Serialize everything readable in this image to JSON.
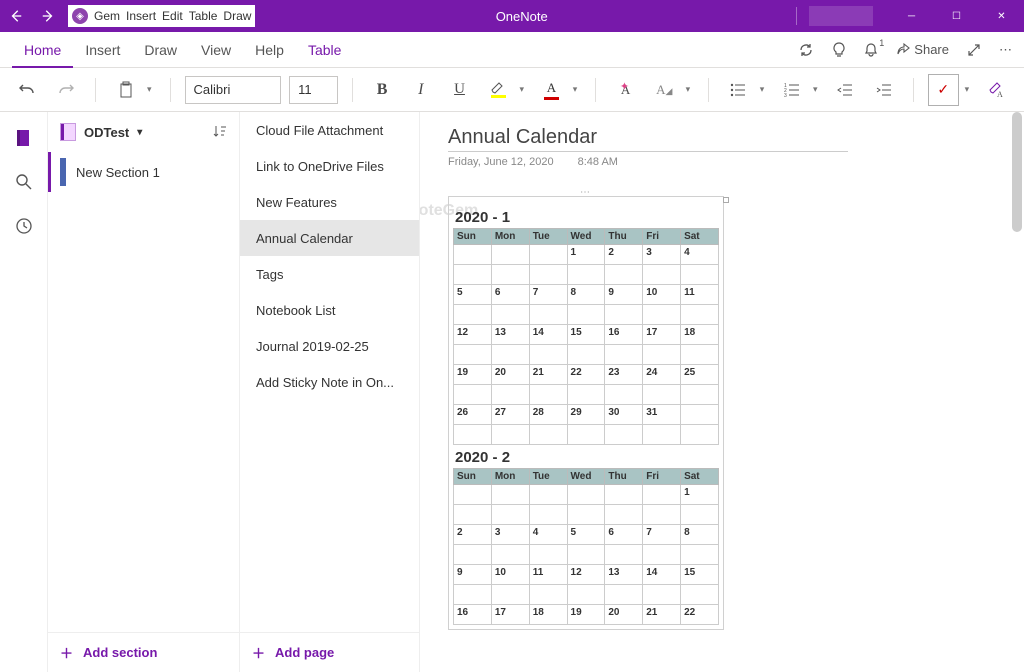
{
  "title_bar": {
    "app_name": "OneNote",
    "gem_menu": {
      "label": "Gem",
      "items": [
        "Insert",
        "Edit",
        "Table",
        "Draw"
      ]
    }
  },
  "ribbon_tabs": {
    "tabs": [
      "Home",
      "Insert",
      "Draw",
      "View",
      "Help",
      "Table"
    ],
    "active": "Home",
    "share_label": "Share",
    "bell_badge": "1"
  },
  "ribbon": {
    "font_name": "Calibri",
    "font_size": "11"
  },
  "notebook": {
    "name": "ODTest",
    "sections": [
      {
        "name": "New Section 1"
      }
    ],
    "add_section": "Add section"
  },
  "pages": {
    "items": [
      "Cloud File Attachment",
      "Link to OneDrive Files",
      "New Features",
      "Annual Calendar",
      "Tags",
      "Notebook List",
      "Journal 2019-02-25",
      "Add Sticky Note in On..."
    ],
    "active_index": 3,
    "add_page": "Add page"
  },
  "page": {
    "title": "Annual Calendar",
    "date": "Friday, June 12, 2020",
    "time": "8:48 AM",
    "watermark": "OneNoteGem",
    "day_headers": [
      "Sun",
      "Mon",
      "Tue",
      "Wed",
      "Thu",
      "Fri",
      "Sat"
    ],
    "months": [
      {
        "title": "2020 - 1",
        "rows": [
          [
            "",
            "",
            "",
            "1",
            "2",
            "3",
            "4"
          ],
          [
            "",
            "",
            "",
            "",
            "",
            "",
            ""
          ],
          [
            "5",
            "6",
            "7",
            "8",
            "9",
            "10",
            "11"
          ],
          [
            "",
            "",
            "",
            "",
            "",
            "",
            ""
          ],
          [
            "12",
            "13",
            "14",
            "15",
            "16",
            "17",
            "18"
          ],
          [
            "",
            "",
            "",
            "",
            "",
            "",
            ""
          ],
          [
            "19",
            "20",
            "21",
            "22",
            "23",
            "24",
            "25"
          ],
          [
            "",
            "",
            "",
            "",
            "",
            "",
            ""
          ],
          [
            "26",
            "27",
            "28",
            "29",
            "30",
            "31",
            ""
          ],
          [
            "",
            "",
            "",
            "",
            "",
            "",
            ""
          ]
        ]
      },
      {
        "title": "2020 - 2",
        "rows": [
          [
            "",
            "",
            "",
            "",
            "",
            "",
            "1"
          ],
          [
            "",
            "",
            "",
            "",
            "",
            "",
            ""
          ],
          [
            "2",
            "3",
            "4",
            "5",
            "6",
            "7",
            "8"
          ],
          [
            "",
            "",
            "",
            "",
            "",
            "",
            ""
          ],
          [
            "9",
            "10",
            "11",
            "12",
            "13",
            "14",
            "15"
          ],
          [
            "",
            "",
            "",
            "",
            "",
            "",
            ""
          ],
          [
            "16",
            "17",
            "18",
            "19",
            "20",
            "21",
            "22"
          ]
        ]
      }
    ]
  }
}
